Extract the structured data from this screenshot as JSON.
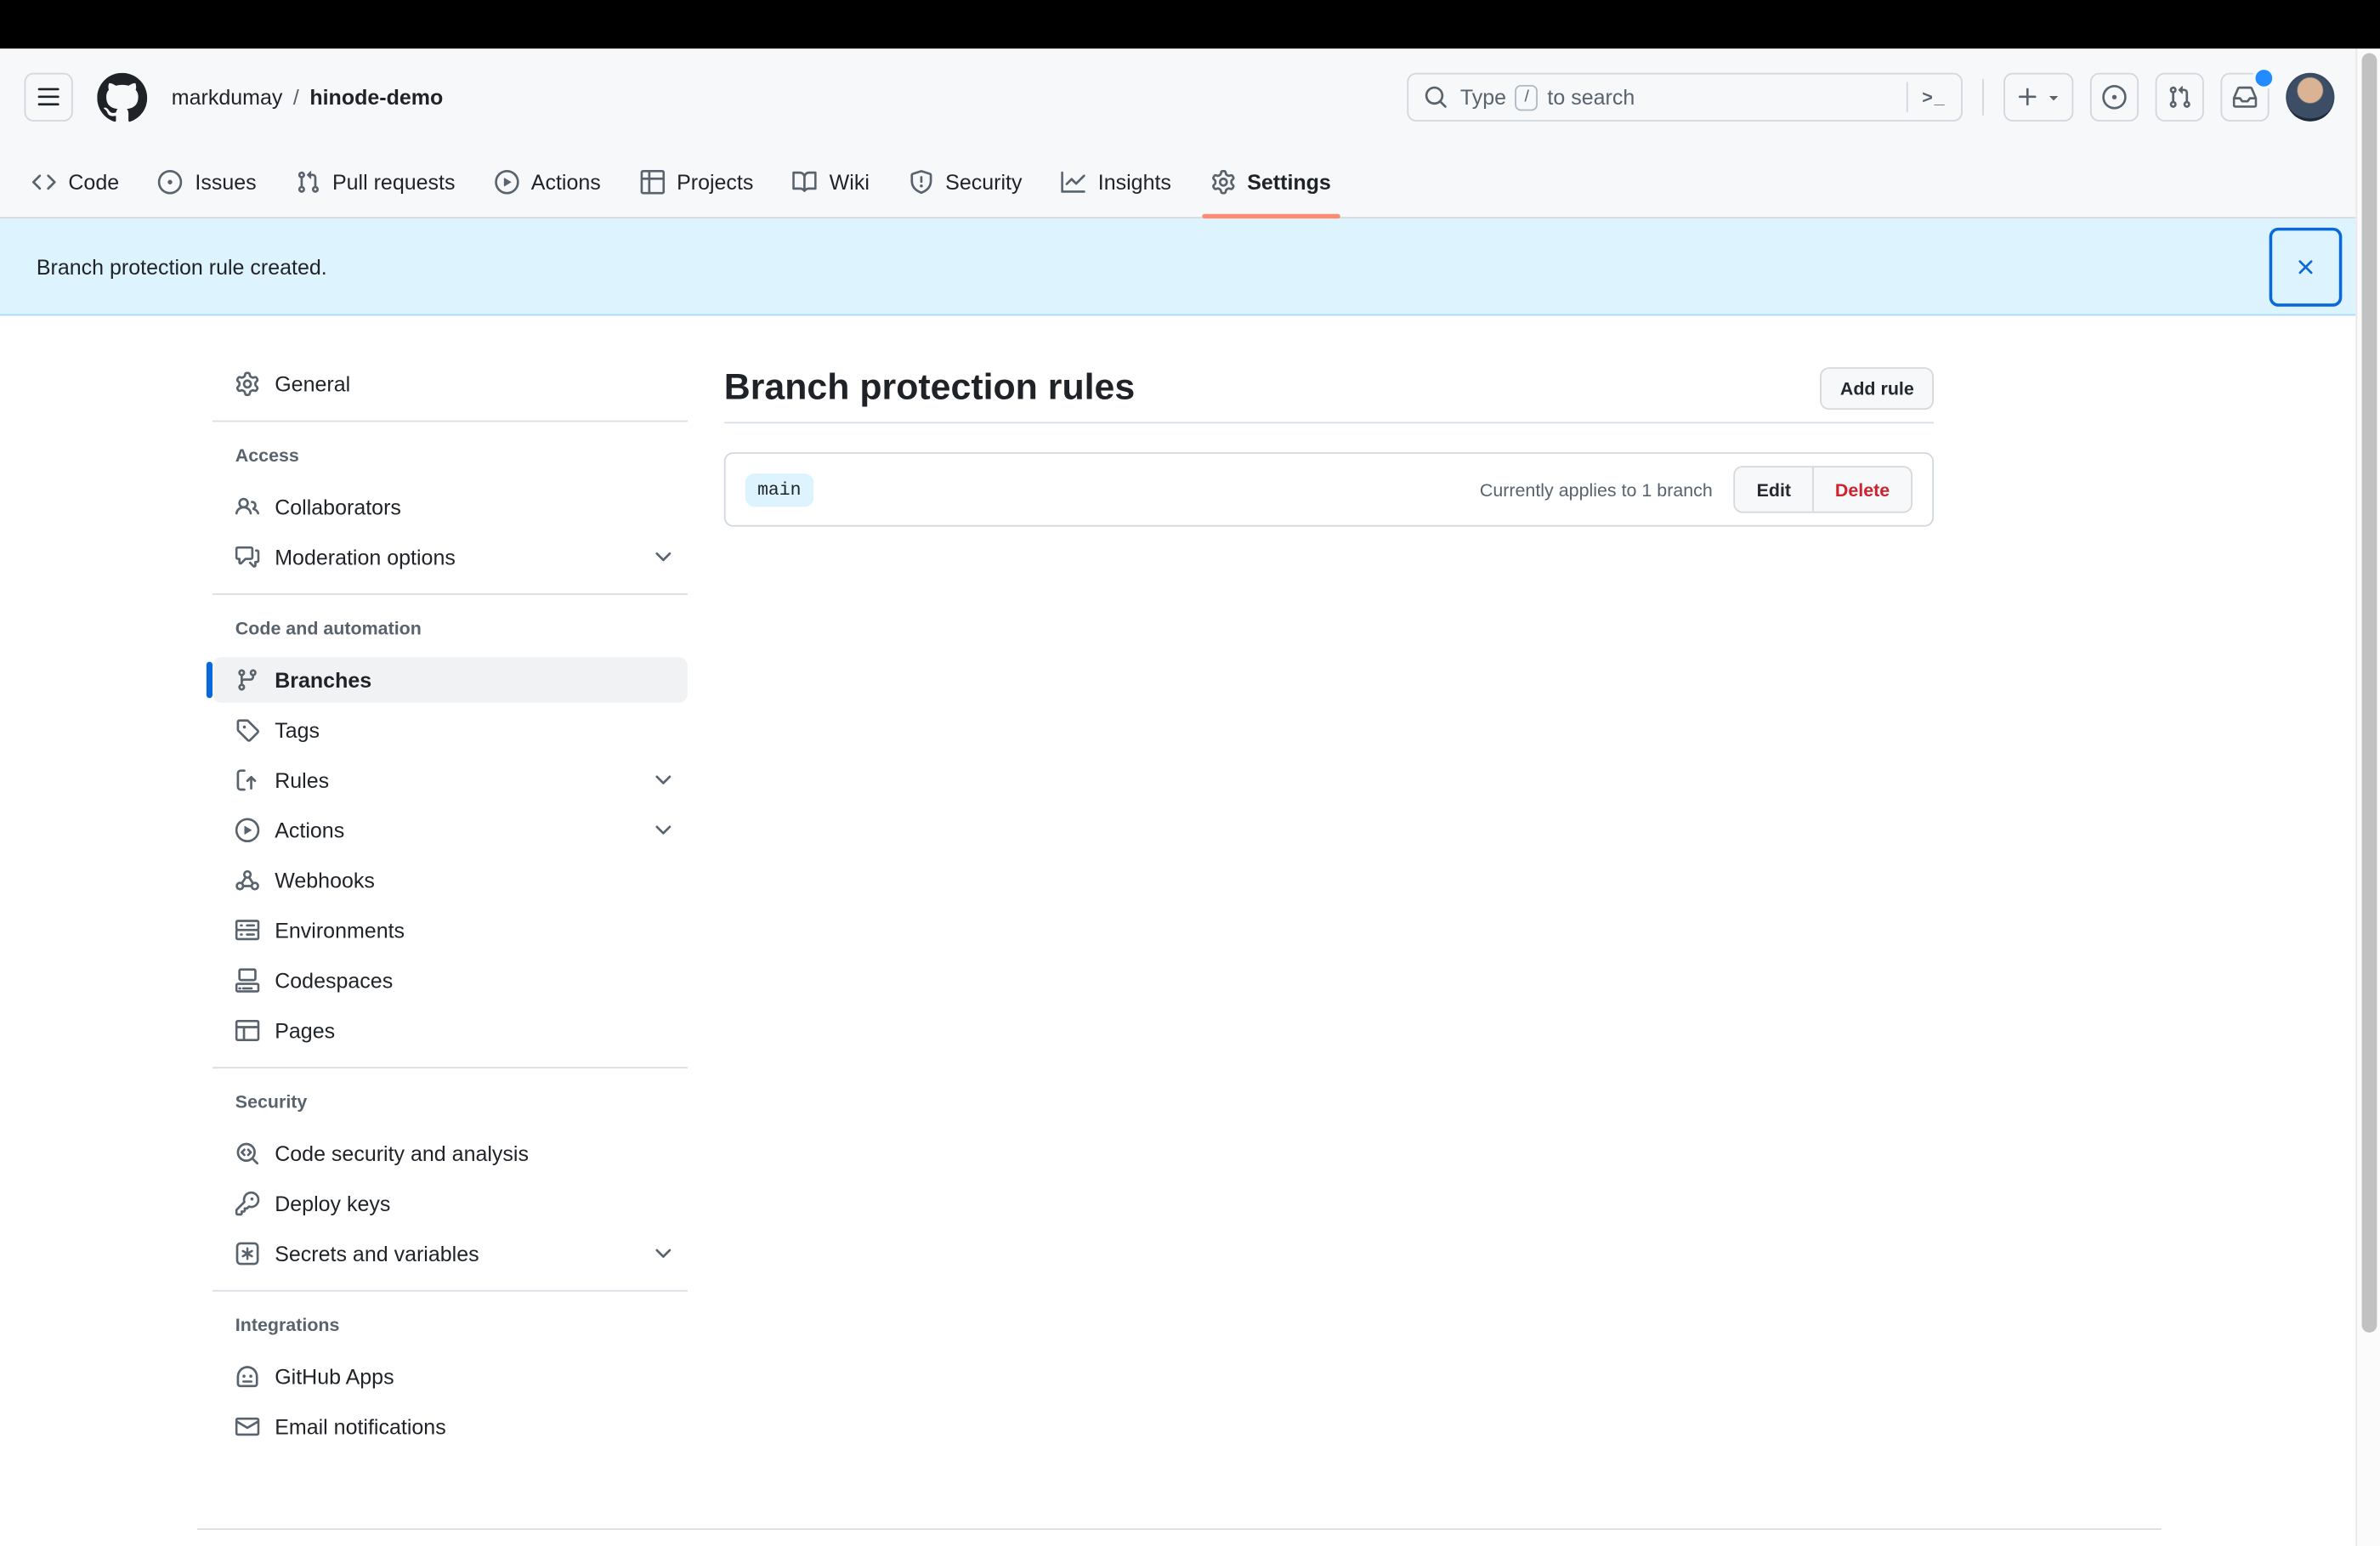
{
  "header": {
    "breadcrumb": {
      "owner": "markdumay",
      "separator": "/",
      "repo": "hinode-demo"
    },
    "search": {
      "text_before": "Type",
      "slash_key": "/",
      "text_after": "to search",
      "terminal_glyph": ">_"
    }
  },
  "nav": {
    "tabs": [
      {
        "label": "Code",
        "icon": "code-icon",
        "active": false
      },
      {
        "label": "Issues",
        "icon": "issue-opened-icon",
        "active": false
      },
      {
        "label": "Pull requests",
        "icon": "git-pull-request-icon",
        "active": false
      },
      {
        "label": "Actions",
        "icon": "play-icon",
        "active": false
      },
      {
        "label": "Projects",
        "icon": "table-icon",
        "active": false
      },
      {
        "label": "Wiki",
        "icon": "book-icon",
        "active": false
      },
      {
        "label": "Security",
        "icon": "shield-icon",
        "active": false
      },
      {
        "label": "Insights",
        "icon": "graph-icon",
        "active": false
      },
      {
        "label": "Settings",
        "icon": "gear-icon",
        "active": true
      }
    ]
  },
  "banner": {
    "message": "Branch protection rule created.",
    "close_icon": "x-icon"
  },
  "sidebar": {
    "sections": [
      {
        "header": "",
        "items": [
          {
            "label": "General",
            "icon": "gear-icon",
            "selected": false,
            "expandable": false
          }
        ]
      },
      {
        "header": "Access",
        "items": [
          {
            "label": "Collaborators",
            "icon": "people-icon",
            "selected": false,
            "expandable": false
          },
          {
            "label": "Moderation options",
            "icon": "comment-discussion-icon",
            "selected": false,
            "expandable": true
          }
        ]
      },
      {
        "header": "Code and automation",
        "items": [
          {
            "label": "Branches",
            "icon": "git-branch-icon",
            "selected": true,
            "expandable": false
          },
          {
            "label": "Tags",
            "icon": "tag-icon",
            "selected": false,
            "expandable": false
          },
          {
            "label": "Rules",
            "icon": "rule-icon",
            "selected": false,
            "expandable": true
          },
          {
            "label": "Actions",
            "icon": "play-icon",
            "selected": false,
            "expandable": true
          },
          {
            "label": "Webhooks",
            "icon": "webhook-icon",
            "selected": false,
            "expandable": false
          },
          {
            "label": "Environments",
            "icon": "server-icon",
            "selected": false,
            "expandable": false
          },
          {
            "label": "Codespaces",
            "icon": "codespaces-icon",
            "selected": false,
            "expandable": false
          },
          {
            "label": "Pages",
            "icon": "browser-icon",
            "selected": false,
            "expandable": false
          }
        ]
      },
      {
        "header": "Security",
        "items": [
          {
            "label": "Code security and analysis",
            "icon": "codescan-icon",
            "selected": false,
            "expandable": false
          },
          {
            "label": "Deploy keys",
            "icon": "key-icon",
            "selected": false,
            "expandable": false
          },
          {
            "label": "Secrets and variables",
            "icon": "asterisk-icon",
            "selected": false,
            "expandable": true
          }
        ]
      },
      {
        "header": "Integrations",
        "items": [
          {
            "label": "GitHub Apps",
            "icon": "hubot-icon",
            "selected": false,
            "expandable": false
          },
          {
            "label": "Email notifications",
            "icon": "mail-icon",
            "selected": false,
            "expandable": false
          }
        ]
      }
    ]
  },
  "main": {
    "heading": "Branch protection rules",
    "add_rule_label": "Add rule",
    "rules": [
      {
        "branch": "main",
        "status": "Currently applies to 1 branch",
        "edit_label": "Edit",
        "delete_label": "Delete"
      }
    ]
  },
  "icons_used": [
    "three-bars-icon",
    "github-mark-icon",
    "search-icon",
    "terminal-icon",
    "plus-icon",
    "triangle-down-icon",
    "issue-opened-icon",
    "git-pull-request-icon",
    "inbox-icon",
    "x-icon",
    "chevron-down-icon"
  ],
  "colors": {
    "accent_blue": "#0969da",
    "banner_bg": "#ddf4ff",
    "header_bg": "#f6f8fa",
    "active_tab_underline": "#fd8c73",
    "delete_red": "#cf222e",
    "notification_dot": "#218bff",
    "text_primary": "#1f2328",
    "text_secondary": "#59636e",
    "border": "#d0d7de"
  }
}
